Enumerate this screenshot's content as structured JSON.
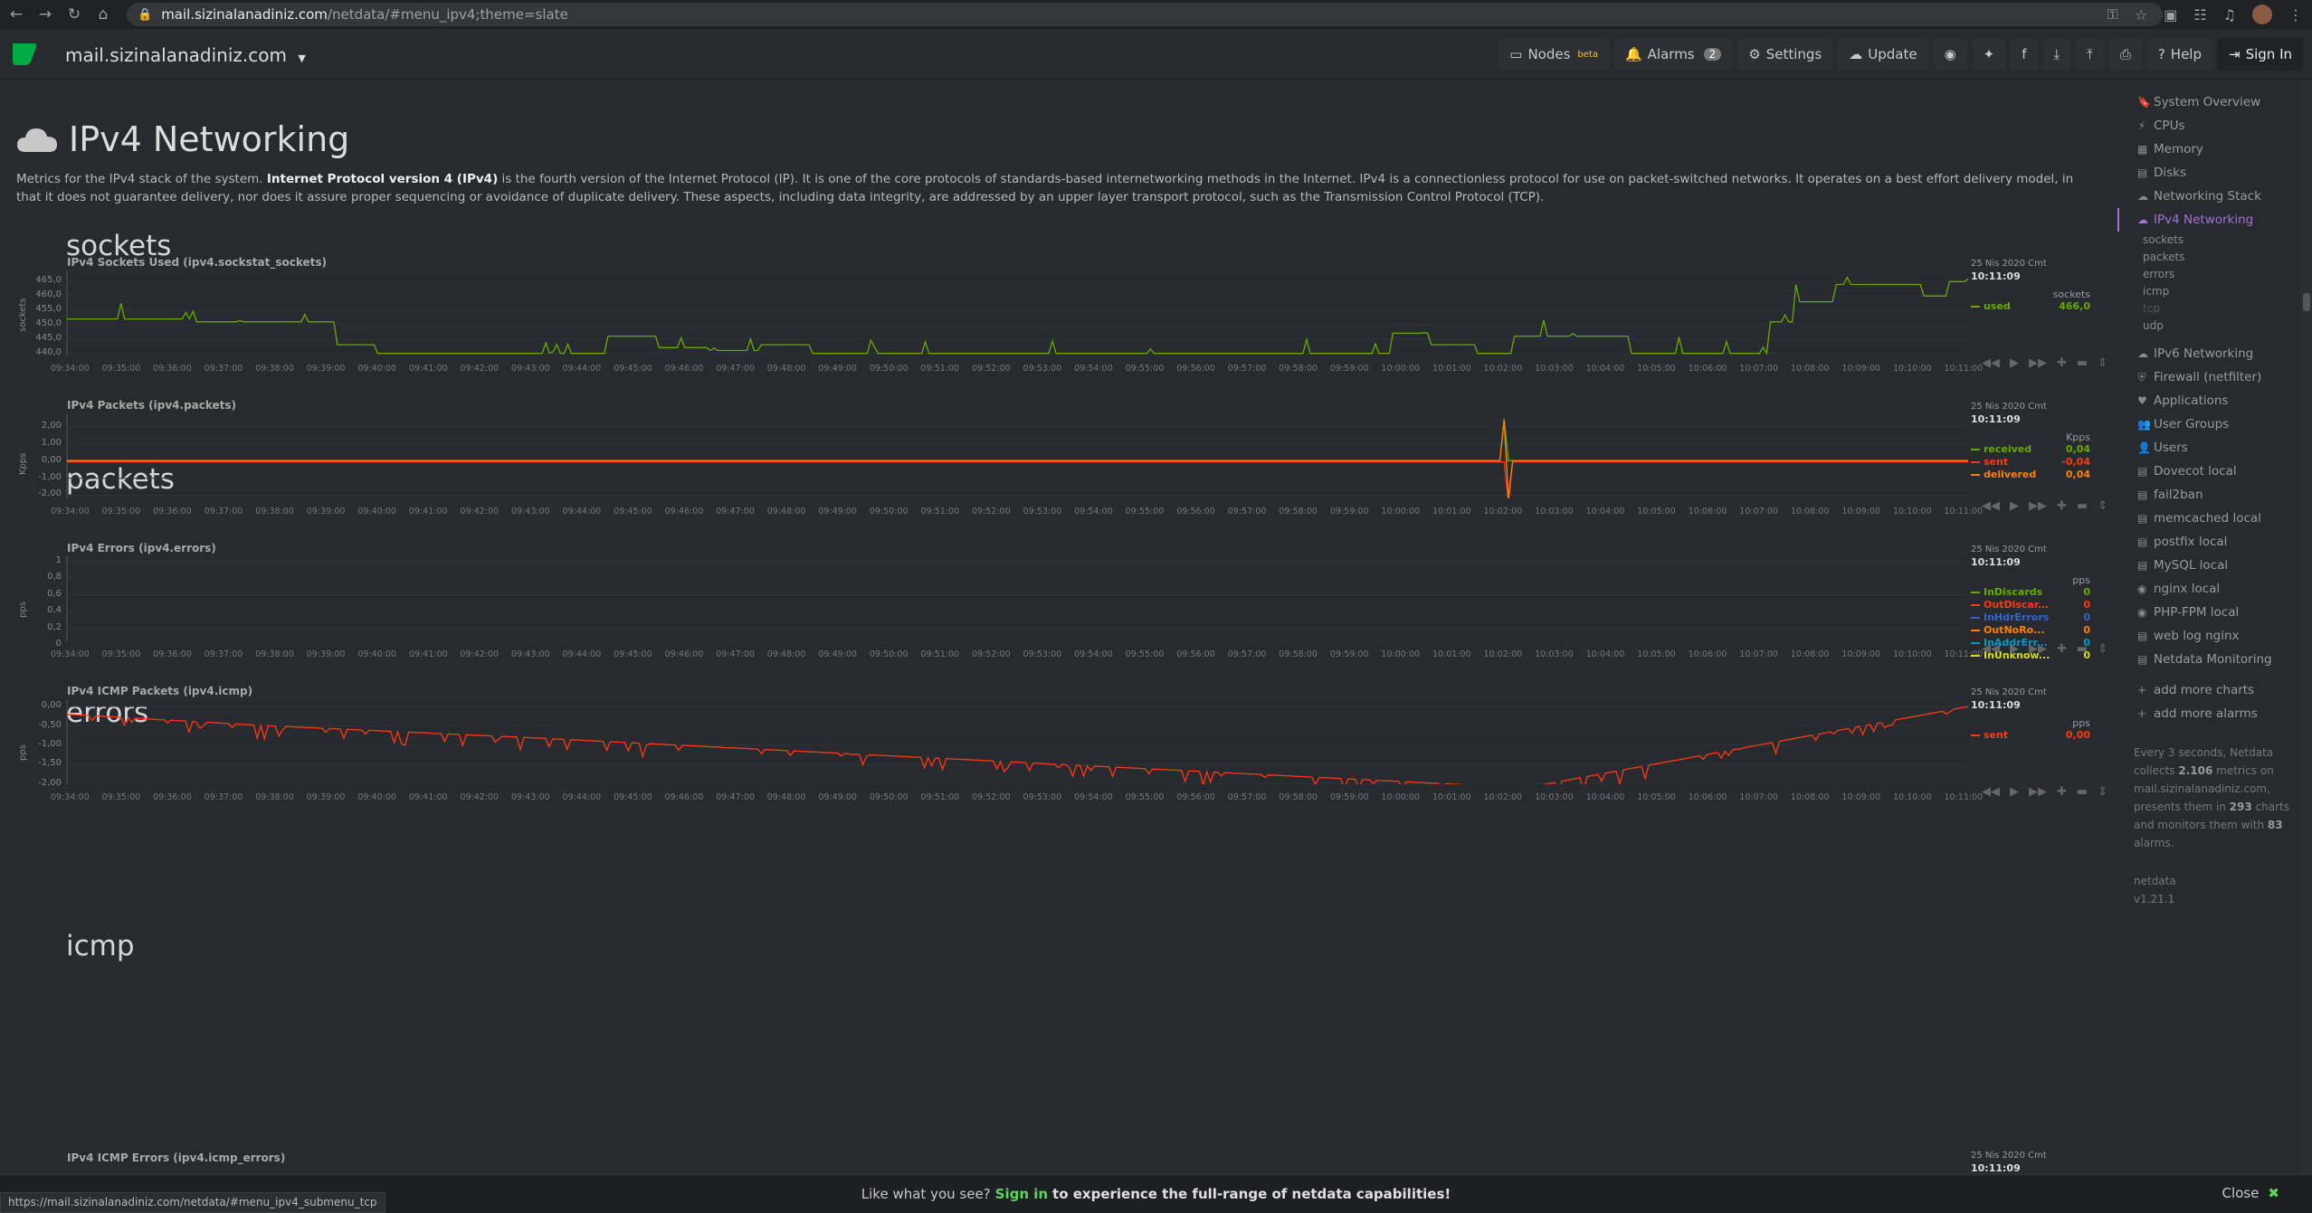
{
  "browser": {
    "url_host": "mail.sizinalanadiniz.com",
    "url_path": "/netdata/#menu_ipv4;theme=slate"
  },
  "navbar": {
    "brand": "mail.sizinalanadiniz.com",
    "nodes": "Nodes",
    "nodes_badge": "beta",
    "alarms": "Alarms",
    "alarms_count": "2",
    "settings": "Settings",
    "update": "Update",
    "help": "Help",
    "sign_in": "Sign In"
  },
  "page": {
    "title": "IPv4 Networking",
    "intro_pre": "Metrics for the IPv4 stack of the system. ",
    "intro_bold": "Internet Protocol version 4 (IPv4)",
    "intro_post": " is the fourth version of the Internet Protocol (IP). It is one of the core protocols of standards-based internetworking methods in the Internet. IPv4 is a connectionless protocol for use on packet-switched networks. It operates on a best effort delivery model, in that it does not guarantee delivery, nor does it assure proper sequencing or avoidance of duplicate delivery. These aspects, including data integrity, are addressed by an upper layer transport protocol, such as the Transmission Control Protocol (TCP)."
  },
  "time_ticks": [
    "09:34:00",
    "09:35:00",
    "09:36:00",
    "09:37:00",
    "09:38:00",
    "09:39:00",
    "09:40:00",
    "09:41:00",
    "09:42:00",
    "09:43:00",
    "09:44:00",
    "09:45:00",
    "09:46:00",
    "09:47:00",
    "09:48:00",
    "09:49:00",
    "09:50:00",
    "09:51:00",
    "09:52:00",
    "09:53:00",
    "09:54:00",
    "09:55:00",
    "09:56:00",
    "09:57:00",
    "09:58:00",
    "09:59:00",
    "10:00:00",
    "10:01:00",
    "10:02:00",
    "10:03:00",
    "10:04:00",
    "10:05:00",
    "10:06:00",
    "10:07:00",
    "10:08:00",
    "10:09:00",
    "10:10:00",
    "10:11:00"
  ],
  "legend_date": "25 Nis 2020 Cmt",
  "legend_time": "10:11:09",
  "sections": {
    "sockets": "sockets",
    "packets": "packets",
    "errors": "errors",
    "icmp": "icmp"
  },
  "chart_data": [
    {
      "type": "line",
      "title": "IPv4 Sockets Used (ipv4.sockstat_sockets)",
      "ylabel": "sockets",
      "units": "sockets",
      "ylim": [
        438,
        467
      ],
      "yticks": [
        "465,0",
        "460,0",
        "455,0",
        "450,0",
        "445,0",
        "440,0"
      ],
      "x": [
        "09:34:00",
        "09:39:00",
        "09:39:30",
        "09:40:30",
        "09:44:00",
        "09:45:00",
        "09:46:00",
        "09:47:00",
        "09:48:00",
        "09:49:00",
        "09:59:30",
        "10:00:15",
        "10:01:00",
        "10:02:00",
        "10:02:30",
        "10:04:00",
        "10:05:00",
        "10:07:00",
        "10:07:30",
        "10:08:00",
        "10:09:00",
        "10:10:00",
        "10:10:30",
        "10:11:00",
        "10:11:09"
      ],
      "series": [
        {
          "name": "used",
          "color": "#66aa00",
          "values": [
            452,
            451,
            443,
            440,
            440,
            446,
            442,
            441,
            443,
            440,
            440,
            447,
            443,
            440,
            446,
            446,
            440,
            440,
            451,
            458,
            464,
            464,
            460,
            465,
            466
          ]
        }
      ],
      "legend_values": [
        "466,0"
      ]
    },
    {
      "type": "line",
      "title": "IPv4 Packets (ipv4.packets)",
      "ylabel": "Kpps",
      "units": "Kpps",
      "ylim": [
        -2.4,
        2.5
      ],
      "yticks": [
        "2,00",
        "1,00",
        "0,00",
        "-1,00",
        "-2,00"
      ],
      "x": [
        "09:34:00",
        "10:02:00",
        "10:02:05",
        "10:02:10",
        "10:02:15",
        "10:02:20",
        "10:11:09"
      ],
      "series": [
        {
          "name": "received",
          "color": "#66aa00",
          "values": [
            0.04,
            0.04,
            2.5,
            0.04,
            0.04,
            0.04,
            0.04
          ]
        },
        {
          "name": "sent",
          "color": "#fe3912",
          "values": [
            -0.04,
            -0.04,
            -0.04,
            -2.4,
            -0.04,
            -0.04,
            -0.04
          ]
        },
        {
          "name": "delivered",
          "color": "#ff8000",
          "values": [
            0.04,
            0.04,
            2.4,
            -2.2,
            0.04,
            0.04,
            0.04
          ]
        }
      ],
      "legend_values": [
        "0,04",
        "-0,04",
        "0,04"
      ]
    },
    {
      "type": "line",
      "title": "IPv4 Errors (ipv4.errors)",
      "ylabel": "pps",
      "units": "pps",
      "ylim": [
        0,
        1
      ],
      "yticks": [
        "1",
        "0,8",
        "0,6",
        "0,4",
        "0,2",
        "0"
      ],
      "x": [
        "09:34:00",
        "10:11:09"
      ],
      "series": [
        {
          "name": "InDiscards",
          "color": "#66aa00",
          "values": [
            0,
            0
          ]
        },
        {
          "name": "OutDiscar...",
          "color": "#fe3912",
          "values": [
            0,
            0
          ]
        },
        {
          "name": "InHdrErrors",
          "color": "#3366cc",
          "values": [
            0,
            0
          ]
        },
        {
          "name": "OutNoRo...",
          "color": "#ff8000",
          "values": [
            0,
            0
          ]
        },
        {
          "name": "InAddrErr...",
          "color": "#0099c6",
          "values": [
            0,
            0
          ]
        },
        {
          "name": "InUnknow...",
          "color": "#dddd00",
          "values": [
            0,
            0
          ]
        }
      ],
      "legend_values": [
        "0",
        "0",
        "0",
        "0",
        "0",
        "0"
      ]
    },
    {
      "type": "line",
      "title": "IPv4 ICMP Packets (ipv4.icmp)",
      "ylabel": "pps",
      "units": "pps",
      "ylim": [
        -2.1,
        0.05
      ],
      "yticks": [
        "0,00",
        "-0,50",
        "-1,00",
        "-1,50",
        "-2,00"
      ],
      "x": [
        "09:34:00",
        "09:38:00",
        "09:43:00",
        "09:47:30",
        "10:02:30",
        "10:11:09"
      ],
      "series": [
        {
          "name": "sent",
          "color": "#fe3912",
          "values": [
            -0.2,
            -0.5,
            -0.8,
            -1.1,
            -2.1,
            0.0
          ]
        }
      ],
      "legend_values": [
        "0,00"
      ]
    }
  ],
  "icmp_errors_title": "IPv4 ICMP Errors (ipv4.icmp_errors)",
  "sidebar": {
    "items": [
      "System Overview",
      "CPUs",
      "Memory",
      "Disks",
      "Networking Stack",
      "IPv4 Networking"
    ],
    "subitems": [
      "sockets",
      "packets",
      "errors",
      "icmp",
      "tcp",
      "udp"
    ],
    "items2": [
      "IPv6 Networking",
      "Firewall (netfilter)",
      "Applications",
      "User Groups",
      "Users",
      "Dovecot local",
      "fail2ban",
      "memcached local",
      "postfix local",
      "MySQL local",
      "nginx local",
      "PHP-FPM local",
      "web log nginx",
      "Netdata Monitoring"
    ],
    "add_charts": "add more charts",
    "add_alarms": "add more alarms",
    "info_1": "Every 3 seconds, Netdata collects ",
    "info_metrics": "2.106",
    "info_2": " metrics on mail.sizinalanadiniz.com, presents them in ",
    "info_charts": "293",
    "info_3": " charts and monitors them with ",
    "info_alarms": "83",
    "info_4": " alarms.",
    "product": "netdata",
    "version": "v1.21.1"
  },
  "banner": {
    "pre": "Like what you see?",
    "link": "Sign in",
    "post": "to experience the full-range of netdata capabilities!",
    "close": "Close"
  },
  "statusbar": "https://mail.sizinalanadiniz.com/netdata/#menu_ipv4_submenu_tcp"
}
